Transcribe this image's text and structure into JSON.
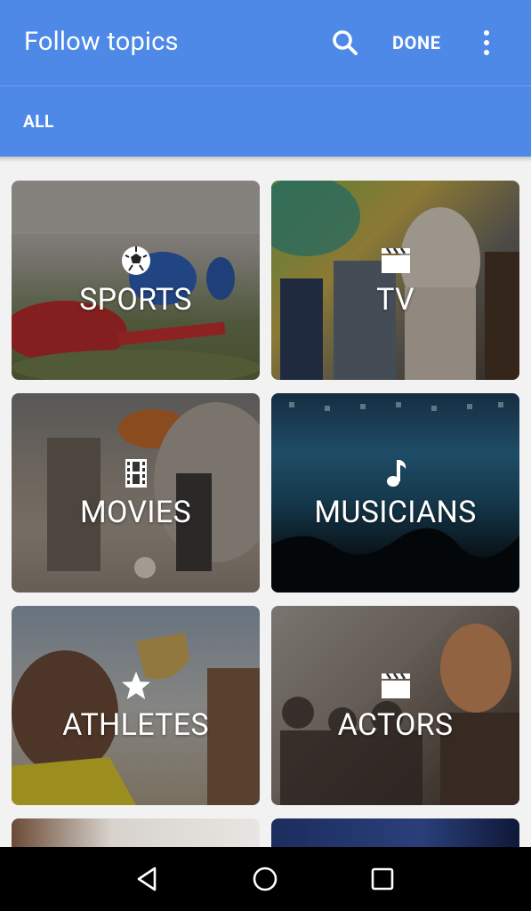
{
  "appbar": {
    "title": "Follow topics",
    "done_label": "DONE",
    "color": "#4e89e8"
  },
  "tabs": [
    {
      "label": "ALL",
      "selected": true
    }
  ],
  "topics": [
    {
      "label": "SPORTS",
      "icon": "soccer-ball-icon"
    },
    {
      "label": "TV",
      "icon": "clapperboard-icon"
    },
    {
      "label": "MOVIES",
      "icon": "film-strip-icon"
    },
    {
      "label": "MUSICIANS",
      "icon": "music-note-icon"
    },
    {
      "label": "ATHLETES",
      "icon": "star-icon"
    },
    {
      "label": "ACTORS",
      "icon": "clapperboard-icon"
    }
  ],
  "navbar": {
    "buttons": [
      "back-icon",
      "home-icon",
      "recents-icon"
    ]
  }
}
